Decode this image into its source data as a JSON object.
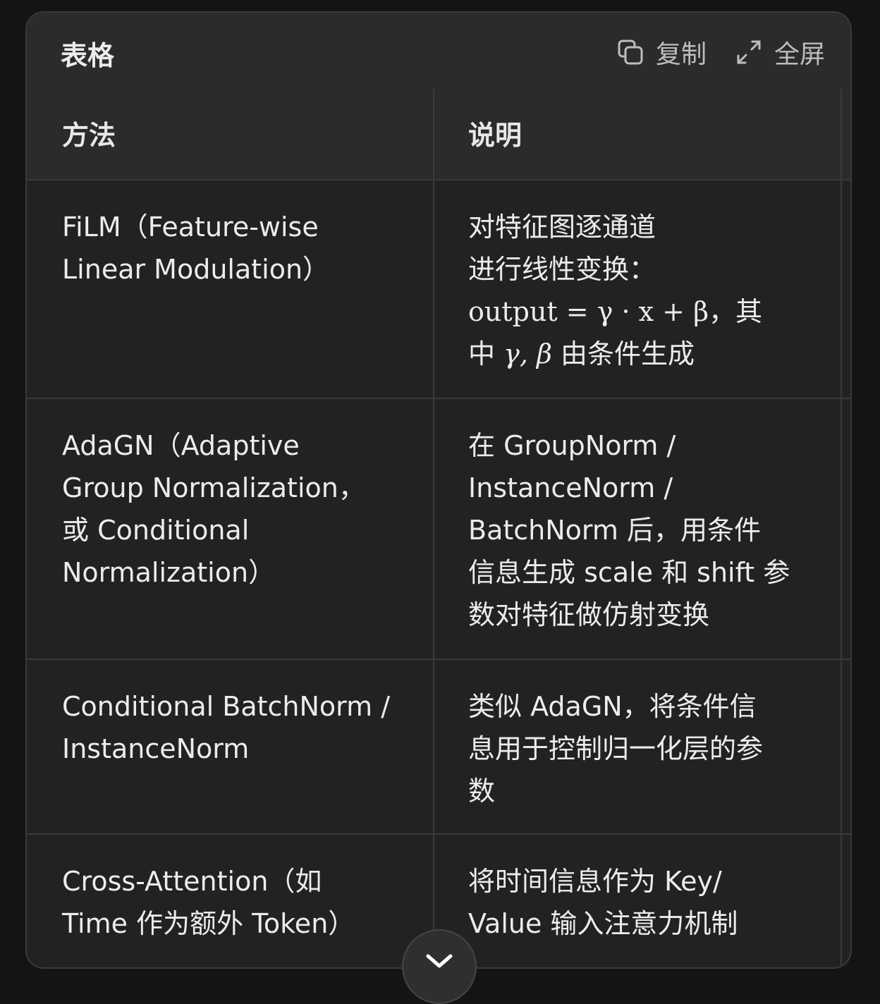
{
  "header": {
    "title": "表格",
    "copy_label": "复制",
    "fullscreen_label": "全屏"
  },
  "table": {
    "columns": [
      "方法",
      "说明"
    ],
    "rows": [
      {
        "method": [
          "FiLM（Feature-wise",
          "Linear Modulation）"
        ],
        "desc_lines": [
          "对特征图逐通道",
          "进行线性变换："
        ],
        "desc_formula": "output = γ · x + β",
        "desc_after_formula": "，其",
        "desc_line4_prefix": "中",
        "desc_line4_math": "γ, β",
        "desc_line4_suffix": "由条件生成"
      },
      {
        "method": [
          "AdaGN（Adaptive",
          "Group Normalization，",
          "或 Conditional",
          "Normalization）"
        ],
        "desc": [
          "在 GroupNorm /",
          "InstanceNorm /",
          "BatchNorm 后，用条件",
          "信息生成 scale 和 shift 参",
          "数对特征做仿射变换"
        ]
      },
      {
        "method": [
          "Conditional BatchNorm /",
          "InstanceNorm"
        ],
        "desc": [
          "类似 AdaGN，将条件信",
          "息用于控制归一化层的参",
          "数"
        ]
      },
      {
        "method": [
          "Cross-Attention（如",
          "Time 作为额外 Token）"
        ],
        "desc": [
          "将时间信息作为 Key/",
          "Value 输入注意力机制"
        ]
      }
    ]
  },
  "icons": {
    "copy": "copy-icon",
    "fullscreen": "expand-icon",
    "scroll_down": "chevron-down-icon"
  }
}
